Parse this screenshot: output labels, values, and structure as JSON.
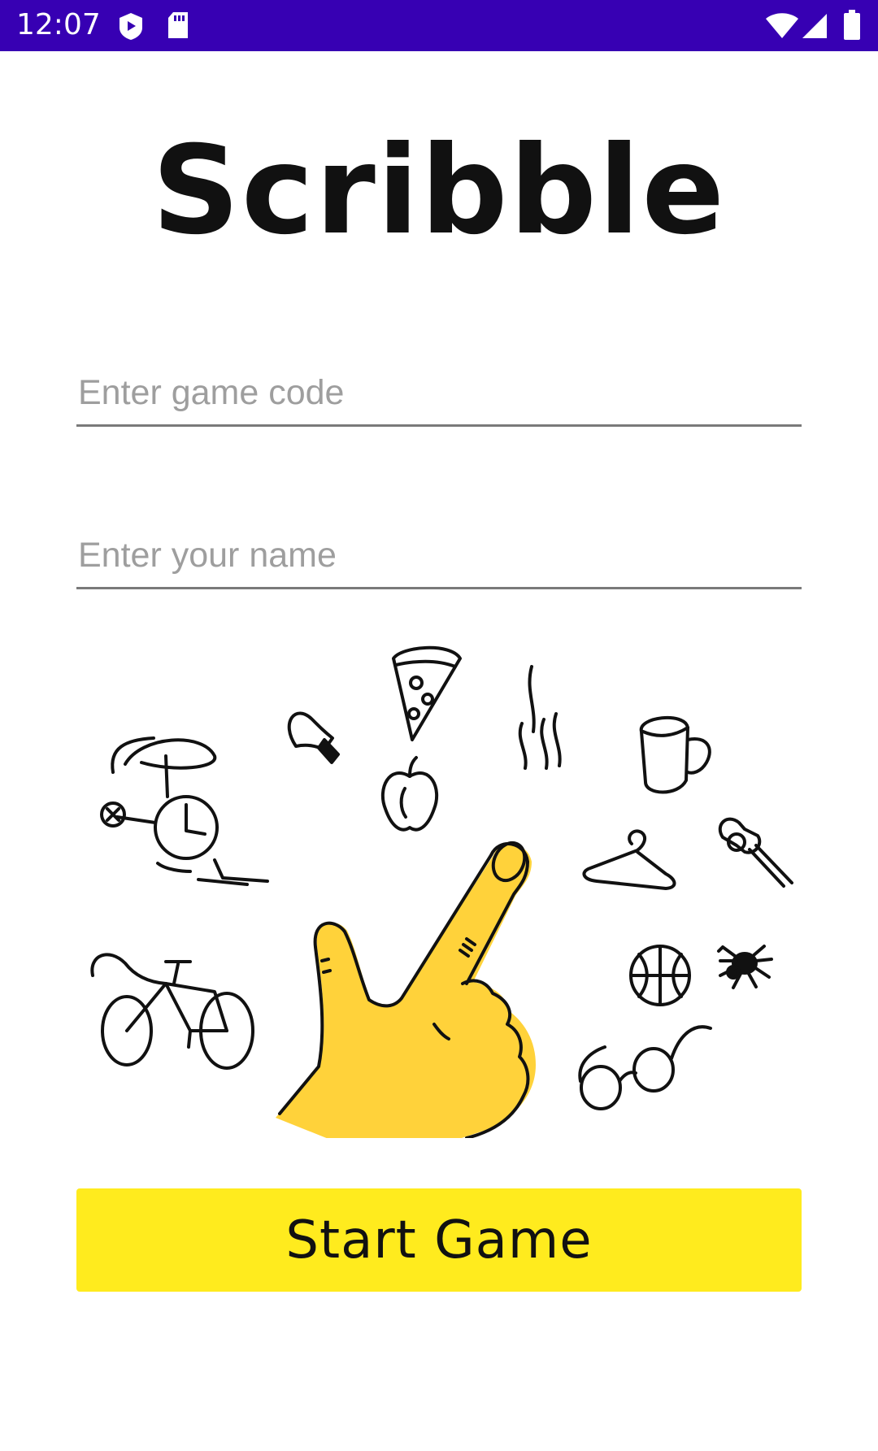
{
  "status_bar": {
    "time": "12:07",
    "icons": [
      "play-shield-icon",
      "sd-card-icon",
      "wifi-icon",
      "cell-signal-icon",
      "battery-icon"
    ],
    "background": "#3700B3"
  },
  "app": {
    "title": "Scribble"
  },
  "form": {
    "game_code": {
      "placeholder": "Enter game code",
      "value": ""
    },
    "name": {
      "placeholder": "Enter your name",
      "value": ""
    }
  },
  "illustration": {
    "icons": [
      "pointing-hand-icon",
      "helicopter-icon",
      "bicycle-icon",
      "lightbulb-icon",
      "pizza-slice-icon",
      "apple-icon",
      "steam-icon",
      "mug-icon",
      "hanger-icon",
      "pushpin-icon",
      "basketball-icon",
      "spider-icon",
      "glasses-icon"
    ],
    "accent": "#FFD23A"
  },
  "actions": {
    "start_label": "Start Game",
    "button_color": "#FFEB1E"
  }
}
